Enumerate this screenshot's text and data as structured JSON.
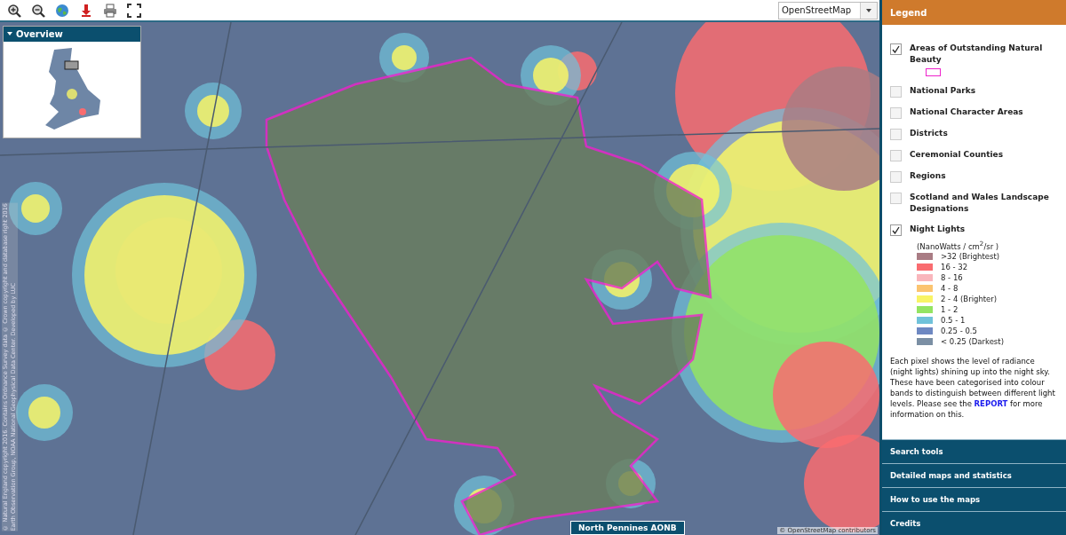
{
  "toolbar": {
    "tools": [
      {
        "kind": "zoom-in"
      },
      {
        "kind": "zoom-out"
      },
      {
        "kind": "globe"
      },
      {
        "kind": "download"
      },
      {
        "kind": "print"
      },
      {
        "kind": "fullscreen"
      }
    ],
    "basemap": {
      "value": "OpenStreetMap"
    }
  },
  "overview": {
    "title": "Overview",
    "expanded": true
  },
  "map": {
    "attribution": "© OpenStreetMap contributors",
    "copyright": [
      "© Natural England copyright 2016. Contains Ordnance Survey data © Crown copyright and database right 2016",
      "Earth Observation Group, NOAA National Geophysical Data Center. Developed by LUC"
    ],
    "popup": "North Pennines AONB"
  },
  "legend": {
    "title": "Legend",
    "items": [
      {
        "label": "Areas of Outstanding Natural Beauty",
        "checked": true,
        "symbol": {
          "kind": "outline",
          "color": "#ee22cc"
        }
      },
      {
        "label": "National Parks",
        "checked": false
      },
      {
        "label": "National Character Areas",
        "checked": false
      },
      {
        "label": "Districts",
        "checked": false
      },
      {
        "label": "Ceremonial Counties",
        "checked": false
      },
      {
        "label": "Regions",
        "checked": false
      },
      {
        "label": "Scotland and Wales Landscape Designations",
        "checked": false
      },
      {
        "label": "Night Lights",
        "checked": true,
        "symbol": {
          "kind": "bands",
          "unit": "(NanoWatts / cm$^{2}$/sr )",
          "bands": [
            {
              "label": ">32 (Brightest)",
              "color": "#a97c84"
            },
            {
              "label": "16 - 32",
              "color": "#f96c70"
            },
            {
              "label": "8 - 16",
              "color": "#f9b6bc"
            },
            {
              "label": "4 - 8",
              "color": "#fbc470"
            },
            {
              "label": "2 - 4 (Brighter)",
              "color": "#f8f466"
            },
            {
              "label": "1 - 2",
              "color": "#94e462"
            },
            {
              "label": "0.5 - 1",
              "color": "#70c2da"
            },
            {
              "label": "0.25 - 0.5",
              "color": "#6e88c2"
            },
            {
              "label": "< 0.25 (Darkest)",
              "color": "#7b8fa4"
            }
          ]
        }
      }
    ],
    "description": {
      "before": "Each pixel shows the level of radiance (night lights) shining up into the night sky. These have been categorised into colour bands to distinguish between different light levels. Please see the",
      "link": "REPORT",
      "after": "for more information on this."
    }
  },
  "sections": [
    {
      "label": "Search tools",
      "expanded": false
    },
    {
      "label": "Detailed maps and statistics",
      "expanded": false
    },
    {
      "label": "How to use the maps",
      "expanded": false
    },
    {
      "label": "Credits",
      "expanded": false
    }
  ]
}
